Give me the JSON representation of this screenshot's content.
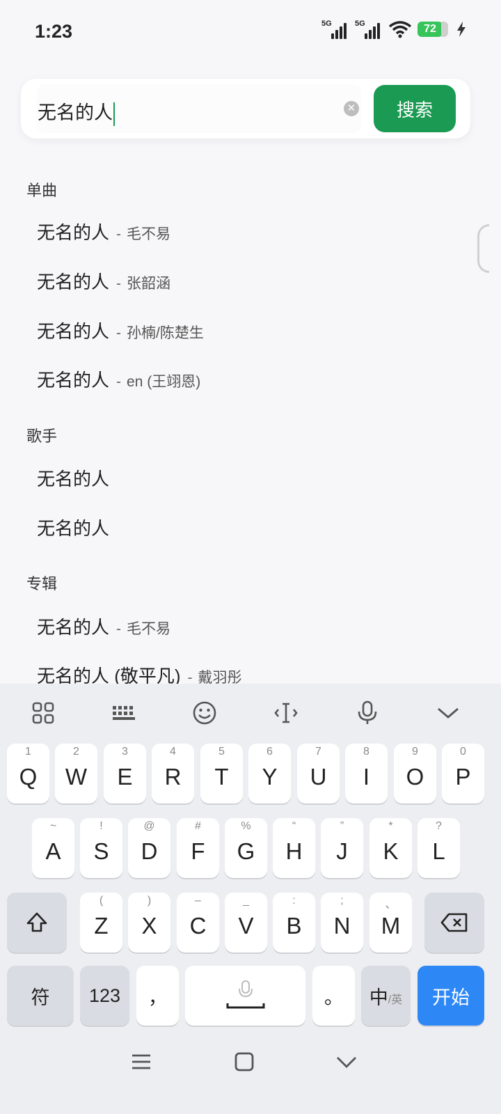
{
  "status_bar": {
    "time": "1:23",
    "network1": "5G",
    "network2": "5G",
    "battery": "72"
  },
  "search": {
    "query": "无名的人",
    "button_label": "搜索"
  },
  "sections": {
    "songs": {
      "title": "单曲",
      "items": [
        {
          "title": "无名的人",
          "sep": "-",
          "artist": "毛不易"
        },
        {
          "title": "无名的人",
          "sep": "-",
          "artist": "张韶涵"
        },
        {
          "title": "无名的人",
          "sep": "-",
          "artist": "孙楠/陈楚生"
        },
        {
          "title": "无名的人",
          "sep": "-",
          "artist": "en (王翊恩)"
        }
      ]
    },
    "singers": {
      "title": "歌手",
      "items": [
        {
          "title": "无名的人"
        },
        {
          "title": "无名的人"
        }
      ]
    },
    "albums": {
      "title": "专辑",
      "items": [
        {
          "title": "无名的人",
          "sep": "-",
          "artist": "毛不易"
        },
        {
          "title": "无名的人 (敬平凡)",
          "sep": "-",
          "artist": "戴羽彤"
        }
      ]
    }
  },
  "keyboard": {
    "row1": [
      {
        "hint": "1",
        "key": "Q"
      },
      {
        "hint": "2",
        "key": "W"
      },
      {
        "hint": "3",
        "key": "E"
      },
      {
        "hint": "4",
        "key": "R"
      },
      {
        "hint": "5",
        "key": "T"
      },
      {
        "hint": "6",
        "key": "Y"
      },
      {
        "hint": "7",
        "key": "U"
      },
      {
        "hint": "8",
        "key": "I"
      },
      {
        "hint": "9",
        "key": "O"
      },
      {
        "hint": "0",
        "key": "P"
      }
    ],
    "row2": [
      {
        "hint": "~",
        "key": "A"
      },
      {
        "hint": "!",
        "key": "S"
      },
      {
        "hint": "@",
        "key": "D"
      },
      {
        "hint": "#",
        "key": "F"
      },
      {
        "hint": "%",
        "key": "G"
      },
      {
        "hint": "“",
        "key": "H"
      },
      {
        "hint": "”",
        "key": "J"
      },
      {
        "hint": "*",
        "key": "K"
      },
      {
        "hint": "?",
        "key": "L"
      }
    ],
    "row3": [
      {
        "hint": "(",
        "key": "Z"
      },
      {
        "hint": ")",
        "key": "X"
      },
      {
        "hint": "–",
        "key": "C"
      },
      {
        "hint": "_",
        "key": "V"
      },
      {
        "hint": ":",
        "key": "B"
      },
      {
        "hint": ";",
        "key": "N"
      },
      {
        "hint": "、",
        "key": "M"
      }
    ],
    "symbols_label": "符",
    "numbers_label": "123",
    "comma_label": "，",
    "period_label": "。",
    "lang_main": "中",
    "lang_alt": "/英",
    "enter_label": "开始"
  },
  "colors": {
    "accent_green": "#1a9a52",
    "key_blue": "#2d87f5",
    "battery_green": "#37c45a"
  },
  "icons": {
    "toolbar": [
      "apps-grid-icon",
      "keyboard-layout-icon",
      "emoji-icon",
      "text-cursor-icon",
      "microphone-icon",
      "chevron-down-icon"
    ],
    "nav": [
      "menu-icon",
      "home-square-icon",
      "back-chevron-icon"
    ]
  }
}
